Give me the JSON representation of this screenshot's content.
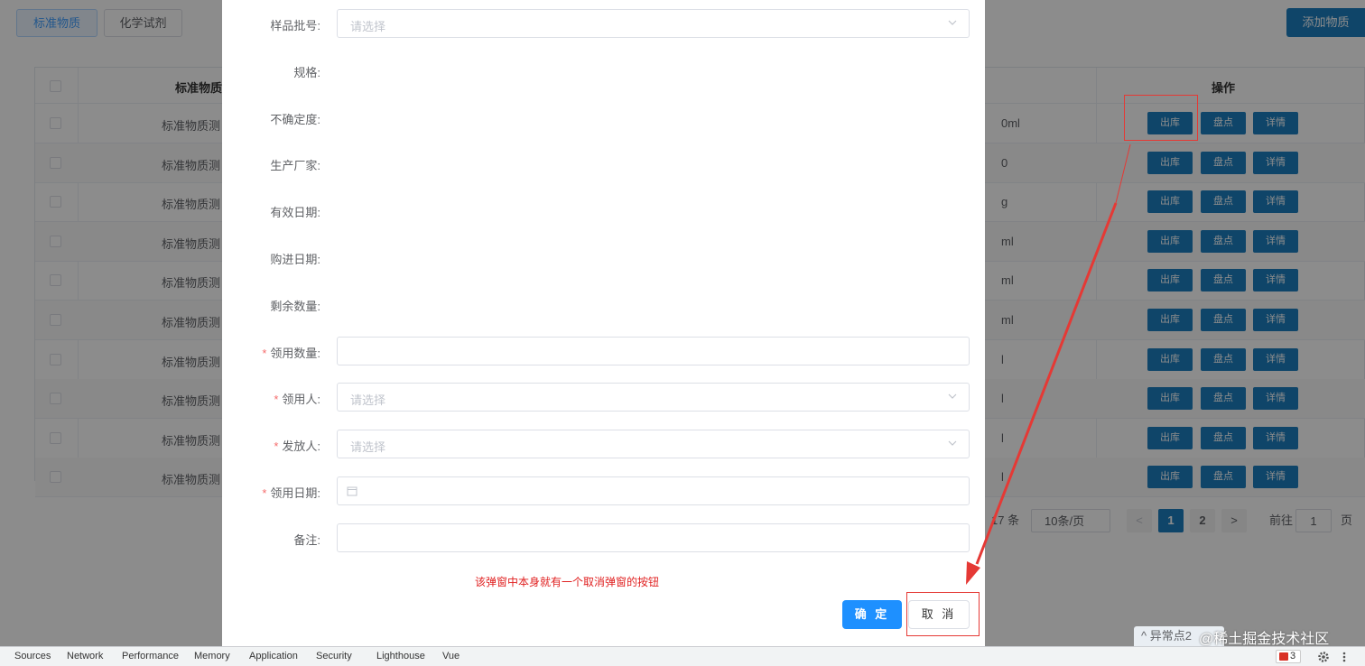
{
  "header": {
    "tabs": [
      {
        "label": "标准物质"
      },
      {
        "label": "化学试剂"
      }
    ],
    "add_button": "添加物质"
  },
  "table": {
    "name_header": "标准物质名",
    "actions_header": "操作",
    "rows": [
      {
        "name": "标准物质测",
        "spec": "0ml"
      },
      {
        "name": "标准物质测",
        "spec": "0"
      },
      {
        "name": "标准物质测",
        "spec": "g"
      },
      {
        "name": "标准物质测",
        "spec": "ml"
      },
      {
        "name": "标准物质测",
        "spec": "ml"
      },
      {
        "name": "标准物质测",
        "spec": "ml"
      },
      {
        "name": "标准物质测",
        "spec": "l"
      },
      {
        "name": "标准物质测",
        "spec": "l"
      },
      {
        "name": "标准物质测",
        "spec": "l"
      },
      {
        "name": "标准物质测",
        "spec": "l"
      }
    ],
    "actions": {
      "out": "出库",
      "check": "盘点",
      "detail": "详情"
    }
  },
  "pagination": {
    "total": "17 条",
    "page_size": "10条/页",
    "pages": [
      "1",
      "2"
    ],
    "current_page": "1",
    "prev": "<",
    "next": ">",
    "goto_prefix": "前往",
    "goto_value": "1",
    "goto_suffix": "页"
  },
  "dialog": {
    "fields": [
      {
        "label": "样品批号:",
        "type": "select",
        "placeholder": "请选择",
        "required": false
      },
      {
        "label": "规格:",
        "type": "static",
        "required": false
      },
      {
        "label": "不确定度:",
        "type": "static",
        "required": false
      },
      {
        "label": "生产厂家:",
        "type": "static",
        "required": false
      },
      {
        "label": "有效日期:",
        "type": "static",
        "required": false
      },
      {
        "label": "购进日期:",
        "type": "static",
        "required": false
      },
      {
        "label": "剩余数量:",
        "type": "static",
        "required": false
      },
      {
        "label": "领用数量:",
        "type": "text",
        "required": true
      },
      {
        "label": "领用人:",
        "type": "select",
        "placeholder": "请选择",
        "required": true
      },
      {
        "label": "发放人:",
        "type": "select",
        "placeholder": "请选择",
        "required": true
      },
      {
        "label": "领用日期:",
        "type": "date",
        "required": true
      },
      {
        "label": "备注:",
        "type": "text",
        "required": false
      }
    ],
    "required_mark": "*",
    "note": "该弹窗中本身就有一个取消弹窗的按钮",
    "confirm": "确 定",
    "cancel": "取 消"
  },
  "floating": {
    "anomaly": "^ 异常点2",
    "watermark": "@稀土掘金技术社区"
  },
  "devtools": {
    "tabs": [
      "Sources",
      "Network",
      "Performance",
      "Memory",
      "Application",
      "Security",
      "Lighthouse",
      "Vue"
    ],
    "issues_count": "3"
  },
  "colors": {
    "primary": "#1c7fbf",
    "confirm": "#1e90ff",
    "annotation": "#e53935"
  }
}
